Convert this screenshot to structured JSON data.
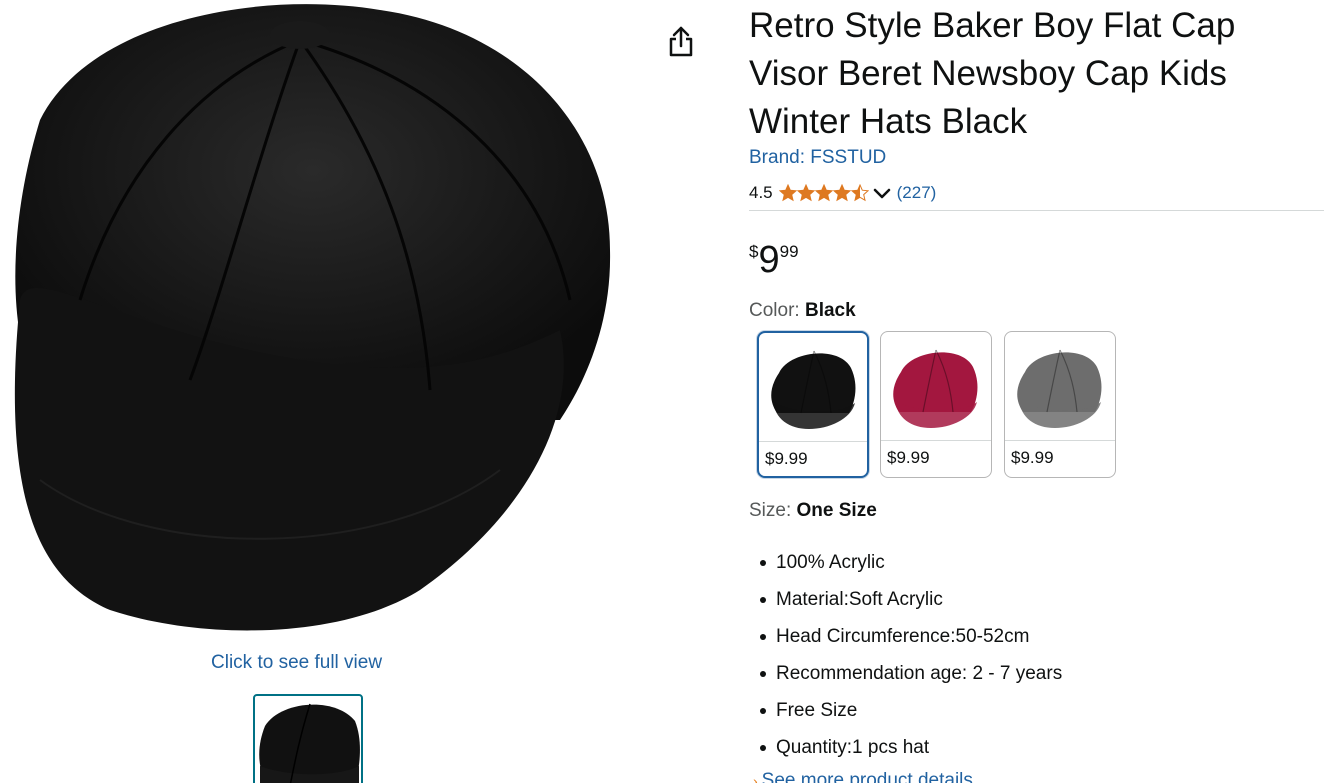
{
  "product": {
    "title": "Retro Style Baker Boy Flat Cap Visor Beret Newsboy Cap Kids Winter Hats Black",
    "brand": "Brand: FSSTUD",
    "rating_value": "4.5",
    "rating_stars": 4.5,
    "rating_count": "(227)",
    "price": {
      "symbol": "$",
      "whole": "9",
      "fraction": "99"
    }
  },
  "gallery": {
    "full_view_link": "Click to see full view"
  },
  "variations": {
    "color_label": "Color: ",
    "color_value": "Black",
    "swatches": [
      {
        "name": "Black",
        "price": "$9.99",
        "color": "#111111",
        "selected": true
      },
      {
        "name": "Wine Red",
        "price": "$9.99",
        "color": "#a3173f",
        "selected": false
      },
      {
        "name": "Gray",
        "price": "$9.99",
        "color": "#6d6d6d",
        "selected": false
      }
    ],
    "size_label": "Size: ",
    "size_value": "One Size"
  },
  "bullets": [
    "100% Acrylic",
    "Material:Soft Acrylic",
    "Head Circumference:50-52cm",
    "Recommendation age: 2 - 7 years",
    "Free Size",
    "Quantity:1 pcs hat"
  ],
  "see_more": "See more product details",
  "colors": {
    "link": "#2162a1",
    "star": "#de7921",
    "text": "#0f1111",
    "muted": "#565959",
    "selected_border": "#2162a1",
    "thumb_border": "#007185"
  },
  "icons": {
    "share": "share-icon",
    "chevron": "chevron-down-icon",
    "star": "star-icon"
  }
}
